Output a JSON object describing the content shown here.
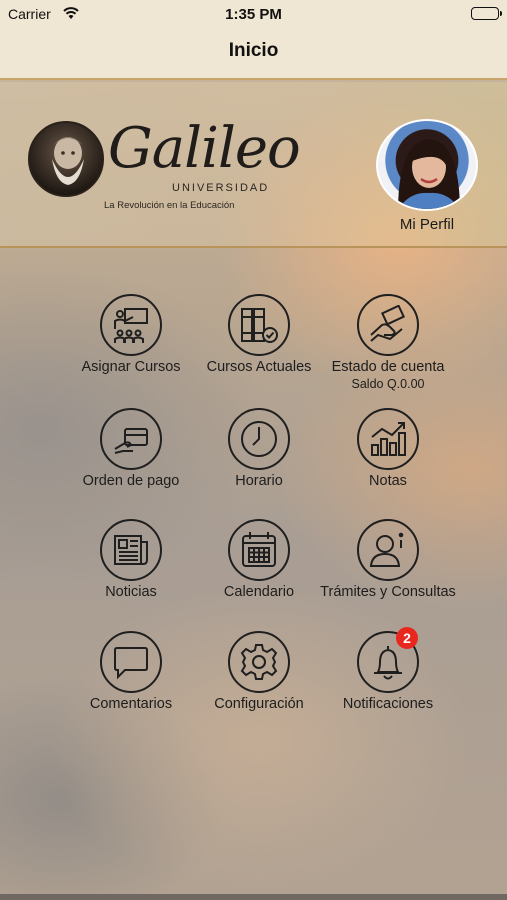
{
  "status_bar": {
    "carrier": "Carrier",
    "time": "1:35 PM"
  },
  "nav": {
    "title": "Inicio"
  },
  "header": {
    "logo_text": "Galileo",
    "logo_subtitle": "UNIVERSIDAD",
    "logo_tagline": "La Revolución en la Educación",
    "profile_label": "Mi Perfil"
  },
  "menu": {
    "asignar_cursos": "Asignar Cursos",
    "cursos_actuales": "Cursos Actuales",
    "estado_cuenta": "Estado de cuenta",
    "saldo": "Saldo Q.0.00",
    "orden_pago": "Orden de pago",
    "horario": "Horario",
    "notas": "Notas",
    "noticias": "Noticias",
    "calendario": "Calendario",
    "tramites": "Trámites y Consultas",
    "comentarios": "Comentarios",
    "configuracion": "Configuración",
    "notificaciones": "Notificaciones",
    "notificaciones_badge": "2"
  },
  "colors": {
    "badge": "#e8271f",
    "nav_background": "#efe6d3",
    "accent_line": "#b8945a"
  },
  "icons": [
    "classroom-icon",
    "books-icon",
    "money-hand-icon",
    "card-hand-icon",
    "clock-icon",
    "bar-chart-icon",
    "newspaper-icon",
    "calendar-icon",
    "person-info-icon",
    "speech-bubble-icon",
    "gear-icon",
    "bell-icon"
  ]
}
